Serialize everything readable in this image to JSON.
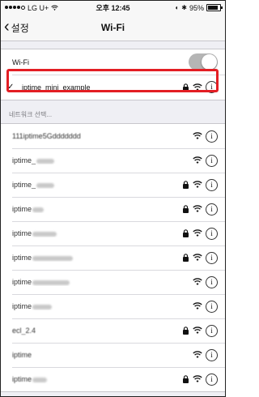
{
  "status_bar": {
    "carrier": "LG U+",
    "time": "오후 12:45",
    "battery": "95%"
  },
  "nav": {
    "back_label": "설정",
    "title": "Wi-Fi"
  },
  "wifi_toggle": {
    "label": "Wi-Fi",
    "on": false
  },
  "connected": {
    "ssid": "iptime_mini_example",
    "secured": true
  },
  "section_header": "네트워크 선택...",
  "networks": [
    {
      "ssid": "111iptime5Gddddddd",
      "locked": false,
      "redacted": true
    },
    {
      "ssid": "iptime_",
      "locked": false
    },
    {
      "ssid": "iptime_",
      "locked": true
    },
    {
      "ssid": "iptime",
      "locked": true
    },
    {
      "ssid": "iptime",
      "locked": true
    },
    {
      "ssid": "iptime",
      "locked": true
    },
    {
      "ssid": "iptime",
      "locked": false
    },
    {
      "ssid": "iptime",
      "locked": false
    },
    {
      "ssid": "ecl_2.4",
      "locked": true
    },
    {
      "ssid": "iptime",
      "locked": false
    },
    {
      "ssid": "iptime",
      "locked": true
    }
  ]
}
